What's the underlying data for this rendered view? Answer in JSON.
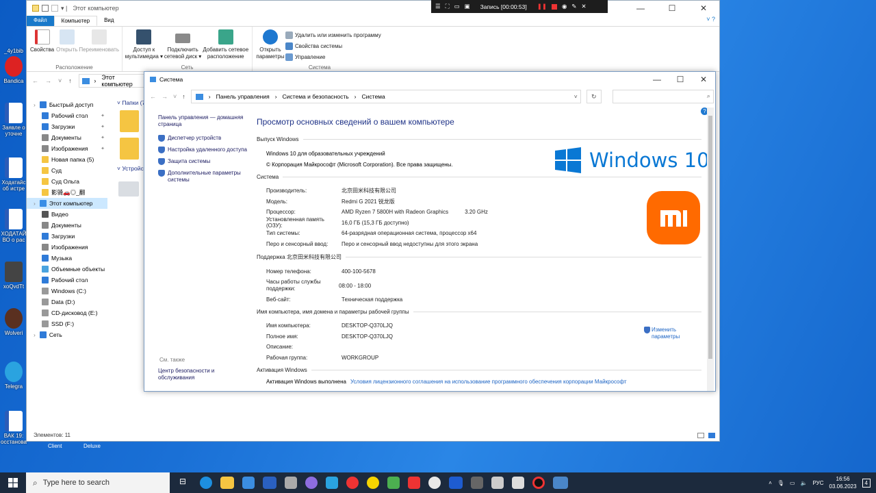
{
  "desktop": {
    "icons": [
      "_4y1bib",
      "Bandica",
      "Заявле о уточне",
      "Ходатайс об истре",
      "ХОДАТАЙ ВО о рас",
      "xoQvdTt",
      "Wolveri",
      "Telegra",
      "ВАК 19: осстанова"
    ],
    "bottom_labels": [
      "Client",
      "Deluxe"
    ]
  },
  "recorder": {
    "label": "Запись [00:00:53]"
  },
  "explorer": {
    "title": "Этот компьютер",
    "tabs": [
      "Файл",
      "Компьютер",
      "Вид"
    ],
    "ribbon": {
      "loc_group": "Расположение",
      "net_group": "Сеть",
      "sys_group": "Система",
      "properties": "Свойства",
      "open": "Открыть",
      "rename": "Переименовать",
      "media": "Доступ к мультимедиа ▾",
      "map_drive": "Подключить сетевой диск ▾",
      "add_loc": "Добавить сетевое расположение",
      "open_params": "Открыть параметры",
      "uninstall": "Удалить или изменить программу",
      "sys_props": "Свойства системы",
      "manage": "Управление"
    },
    "address": "Этот компьютер",
    "folders_header": "Папки (7)",
    "devices_header": "Устройств",
    "nav": [
      {
        "label": "Быстрый доступ",
        "top": true,
        "color": "#2f7bd8"
      },
      {
        "label": "Рабочий стол",
        "pin": "✦",
        "color": "#2f7bd8"
      },
      {
        "label": "Загрузки",
        "pin": "✦",
        "color": "#2f7bd8"
      },
      {
        "label": "Документы",
        "pin": "✦",
        "color": "#888"
      },
      {
        "label": "Изображения",
        "pin": "✦",
        "color": "#888"
      },
      {
        "label": "Новая папка (5)",
        "color": "#f5c542"
      },
      {
        "label": "Суд",
        "color": "#f5c542"
      },
      {
        "label": "Суд Ольга",
        "color": "#f5c542"
      },
      {
        "label": "影骑🚗◎_翻",
        "color": "#f5c542"
      },
      {
        "label": "Этот компьютер",
        "top": true,
        "sel": true,
        "color": "#3a8ee6"
      },
      {
        "label": "Видео",
        "color": "#555"
      },
      {
        "label": "Документы",
        "color": "#888"
      },
      {
        "label": "Загрузки",
        "color": "#2f7bd8"
      },
      {
        "label": "Изображения",
        "color": "#888"
      },
      {
        "label": "Музыка",
        "color": "#2f7bd8"
      },
      {
        "label": "Объемные объекты",
        "color": "#4aa3df"
      },
      {
        "label": "Рабочий стол",
        "color": "#2f7bd8"
      },
      {
        "label": "Windows (C:)",
        "color": "#999"
      },
      {
        "label": "Data (D:)",
        "color": "#999"
      },
      {
        "label": "CD-дисковод (E:)",
        "color": "#999"
      },
      {
        "label": "SSD (F:)",
        "color": "#999"
      },
      {
        "label": "Сеть",
        "top": true,
        "color": "#2f7bd8"
      }
    ],
    "status": "Элементов: 11"
  },
  "system": {
    "title": "Система",
    "breadcrumb": [
      "Панель управления",
      "Система и безопасность",
      "Система"
    ],
    "left_links": [
      "Панель управления — домашняя страница",
      "Диспетчер устройств",
      "Настройка удаленного доступа",
      "Защита системы",
      "Дополнительные параметры системы"
    ],
    "see_also": "См. также",
    "see_also_link": "Центр безопасности и обслуживания",
    "heading": "Просмотр основных сведений о вашем компьютере",
    "edition_header": "Выпуск Windows",
    "edition": "Windows 10 для образовательных учреждений",
    "copyright": "© Корпорация Майкрософт (Microsoft Corporation). Все права защищены.",
    "win_logo": "Windows 10",
    "system_header": "Система",
    "system_rows": [
      {
        "k": "Производитель:",
        "v": "北京田米科技有限公司"
      },
      {
        "k": "Модель:",
        "v": "Redmi G 2021 锐龙版"
      },
      {
        "k": "Процессор:",
        "v": "AMD Ryzen 7 5800H with Radeon Graphics",
        "v2": "3.20 GHz"
      },
      {
        "k": "Установленная память (ОЗУ):",
        "v": "16,0 ГБ (15,3 ГБ доступно)"
      },
      {
        "k": "Тип системы:",
        "v": "64-разрядная операционная система, процессор x64"
      },
      {
        "k": "Перо и сенсорный ввод:",
        "v": "Перо и сенсорный ввод недоступны для этого экрана"
      }
    ],
    "support_header": "Поддержка 北京田米科技有限公司",
    "support_rows": [
      {
        "k": "Номер телефона:",
        "v": "400-100-5678"
      },
      {
        "k": "Часы работы службы поддержки:",
        "v": "08:00 - 18:00"
      },
      {
        "k": "Веб-сайт:",
        "v": "Техническая поддержка",
        "link": true
      }
    ],
    "name_header": "Имя компьютера, имя домена и параметры рабочей группы",
    "name_rows": [
      {
        "k": "Имя компьютера:",
        "v": "DESKTOP-Q370LJQ"
      },
      {
        "k": "Полное имя:",
        "v": "DESKTOP-Q370LJQ"
      },
      {
        "k": "Описание:",
        "v": ""
      },
      {
        "k": "Рабочая группа:",
        "v": "WORKGROUP"
      }
    ],
    "change_params": "Изменить параметры",
    "activation_header": "Активация Windows",
    "activation_text": "Активация Windows выполнена",
    "activation_link": "Условия лицензионного соглашения на использование программного обеспечения корпорации Майкрософт"
  },
  "taskbar": {
    "search_placeholder": "Type here to search",
    "lang": "РУС",
    "time": "16:56",
    "date": "03.06.2023",
    "notif": "4"
  }
}
